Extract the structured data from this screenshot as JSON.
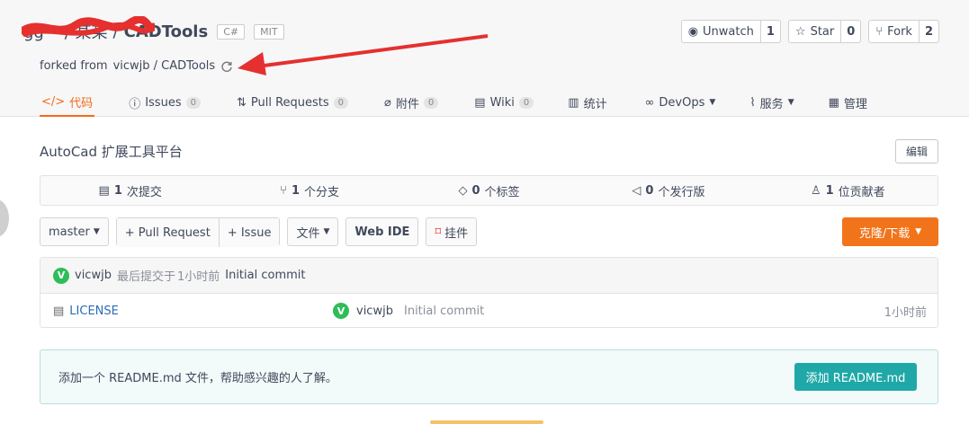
{
  "repo": {
    "owner": "gg··· / 某某",
    "separator": "/",
    "name": "CADTools",
    "badges": [
      "C#",
      "MIT"
    ],
    "forked_prefix": "forked from",
    "forked_source": "vicwjb / CADTools"
  },
  "actions": {
    "watch_label": "Unwatch",
    "watch_count": "1",
    "star_label": "Star",
    "star_count": "0",
    "fork_label": "Fork",
    "fork_count": "2"
  },
  "tabs": [
    {
      "label": "代码",
      "icon": "code-icon"
    },
    {
      "label": "Issues",
      "badge": "0",
      "icon": "issue-icon"
    },
    {
      "label": "Pull Requests",
      "badge": "0",
      "icon": "pr-icon"
    },
    {
      "label": "附件",
      "badge": "0",
      "icon": "paperclip-icon"
    },
    {
      "label": "Wiki",
      "badge": "0",
      "icon": "book-icon"
    },
    {
      "label": "统计",
      "icon": "bar-chart-icon"
    },
    {
      "label": "DevOps",
      "icon": "infinity-icon"
    },
    {
      "label": "服务",
      "icon": "pulse-icon"
    },
    {
      "label": "管理",
      "icon": "settings-doc-icon"
    }
  ],
  "description": "AutoCad 扩展工具平台",
  "edit_label": "编辑",
  "stats": {
    "commits_num": "1",
    "commits_label": "次提交",
    "branches_num": "1",
    "branches_label": "个分支",
    "tags_num": "0",
    "tags_label": "个标签",
    "releases_num": "0",
    "releases_label": "个发行版",
    "contributors_num": "1",
    "contributors_label": "位贡献者"
  },
  "toolbar": {
    "branch": "master",
    "pull_request": "+ Pull Request",
    "issue": "+ Issue",
    "file": "文件",
    "webide": "Web IDE",
    "pin": "挂件",
    "clone": "克隆/下载"
  },
  "latest_commit": {
    "avatar": "V",
    "author": "vicwjb",
    "middle": "最后提交于",
    "time": "1小时前",
    "message": "Initial commit"
  },
  "files": [
    {
      "name": "LICENSE",
      "avatar": "V",
      "author": "vicwjb",
      "message": "Initial commit",
      "time": "1小时前"
    }
  ],
  "readme": {
    "text": "添加一个 README.md 文件，帮助感兴趣的人了解。",
    "button": "添加 README.md"
  },
  "colors": {
    "accent": "#f2741a",
    "teal": "#20a8a8",
    "green_avatar": "#2ebd59",
    "arrow_red": "#e5302f"
  }
}
